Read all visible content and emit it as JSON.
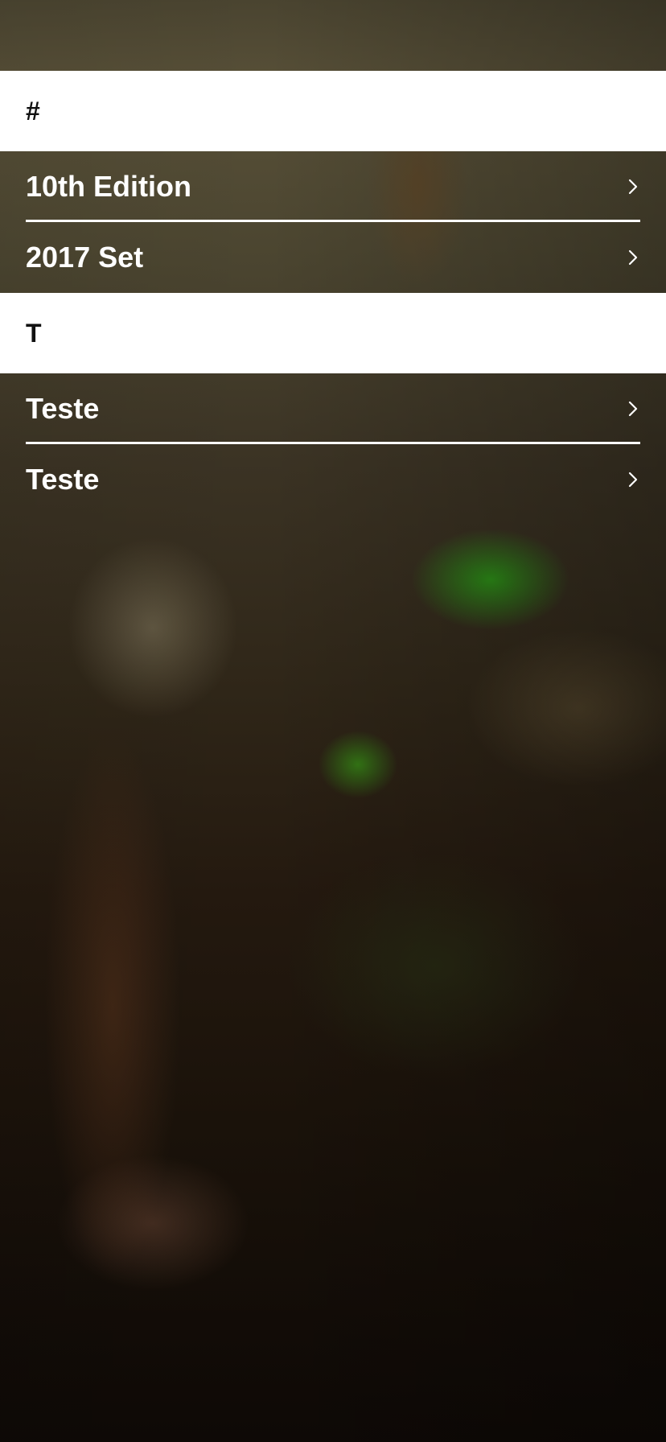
{
  "sections": [
    {
      "header": "#",
      "items": [
        {
          "label": "10th Edition"
        },
        {
          "label": "2017 Set"
        }
      ]
    },
    {
      "header": "T",
      "items": [
        {
          "label": "Teste"
        },
        {
          "label": "Teste"
        }
      ]
    }
  ],
  "icons": {
    "row_accessory": "chevron-right-icon"
  },
  "colors": {
    "section_header_background": "#ffffff",
    "section_header_text": "#111111",
    "row_text": "#ffffff",
    "divider": "#ffffff"
  }
}
